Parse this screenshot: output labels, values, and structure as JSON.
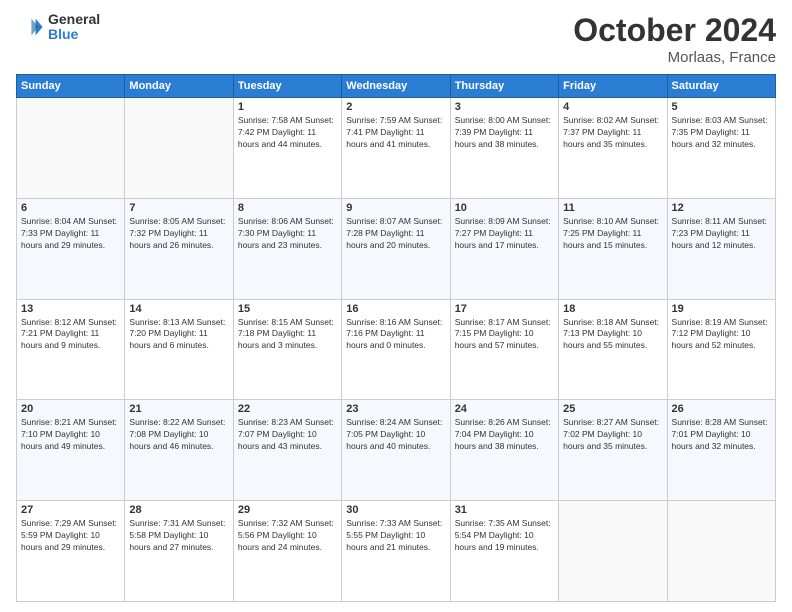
{
  "header": {
    "logo_general": "General",
    "logo_blue": "Blue",
    "title": "October 2024",
    "location": "Morlaas, France"
  },
  "weekdays": [
    "Sunday",
    "Monday",
    "Tuesday",
    "Wednesday",
    "Thursday",
    "Friday",
    "Saturday"
  ],
  "weeks": [
    [
      {
        "day": "",
        "info": ""
      },
      {
        "day": "",
        "info": ""
      },
      {
        "day": "1",
        "info": "Sunrise: 7:58 AM\nSunset: 7:42 PM\nDaylight: 11 hours and 44 minutes."
      },
      {
        "day": "2",
        "info": "Sunrise: 7:59 AM\nSunset: 7:41 PM\nDaylight: 11 hours and 41 minutes."
      },
      {
        "day": "3",
        "info": "Sunrise: 8:00 AM\nSunset: 7:39 PM\nDaylight: 11 hours and 38 minutes."
      },
      {
        "day": "4",
        "info": "Sunrise: 8:02 AM\nSunset: 7:37 PM\nDaylight: 11 hours and 35 minutes."
      },
      {
        "day": "5",
        "info": "Sunrise: 8:03 AM\nSunset: 7:35 PM\nDaylight: 11 hours and 32 minutes."
      }
    ],
    [
      {
        "day": "6",
        "info": "Sunrise: 8:04 AM\nSunset: 7:33 PM\nDaylight: 11 hours and 29 minutes."
      },
      {
        "day": "7",
        "info": "Sunrise: 8:05 AM\nSunset: 7:32 PM\nDaylight: 11 hours and 26 minutes."
      },
      {
        "day": "8",
        "info": "Sunrise: 8:06 AM\nSunset: 7:30 PM\nDaylight: 11 hours and 23 minutes."
      },
      {
        "day": "9",
        "info": "Sunrise: 8:07 AM\nSunset: 7:28 PM\nDaylight: 11 hours and 20 minutes."
      },
      {
        "day": "10",
        "info": "Sunrise: 8:09 AM\nSunset: 7:27 PM\nDaylight: 11 hours and 17 minutes."
      },
      {
        "day": "11",
        "info": "Sunrise: 8:10 AM\nSunset: 7:25 PM\nDaylight: 11 hours and 15 minutes."
      },
      {
        "day": "12",
        "info": "Sunrise: 8:11 AM\nSunset: 7:23 PM\nDaylight: 11 hours and 12 minutes."
      }
    ],
    [
      {
        "day": "13",
        "info": "Sunrise: 8:12 AM\nSunset: 7:21 PM\nDaylight: 11 hours and 9 minutes."
      },
      {
        "day": "14",
        "info": "Sunrise: 8:13 AM\nSunset: 7:20 PM\nDaylight: 11 hours and 6 minutes."
      },
      {
        "day": "15",
        "info": "Sunrise: 8:15 AM\nSunset: 7:18 PM\nDaylight: 11 hours and 3 minutes."
      },
      {
        "day": "16",
        "info": "Sunrise: 8:16 AM\nSunset: 7:16 PM\nDaylight: 11 hours and 0 minutes."
      },
      {
        "day": "17",
        "info": "Sunrise: 8:17 AM\nSunset: 7:15 PM\nDaylight: 10 hours and 57 minutes."
      },
      {
        "day": "18",
        "info": "Sunrise: 8:18 AM\nSunset: 7:13 PM\nDaylight: 10 hours and 55 minutes."
      },
      {
        "day": "19",
        "info": "Sunrise: 8:19 AM\nSunset: 7:12 PM\nDaylight: 10 hours and 52 minutes."
      }
    ],
    [
      {
        "day": "20",
        "info": "Sunrise: 8:21 AM\nSunset: 7:10 PM\nDaylight: 10 hours and 49 minutes."
      },
      {
        "day": "21",
        "info": "Sunrise: 8:22 AM\nSunset: 7:08 PM\nDaylight: 10 hours and 46 minutes."
      },
      {
        "day": "22",
        "info": "Sunrise: 8:23 AM\nSunset: 7:07 PM\nDaylight: 10 hours and 43 minutes."
      },
      {
        "day": "23",
        "info": "Sunrise: 8:24 AM\nSunset: 7:05 PM\nDaylight: 10 hours and 40 minutes."
      },
      {
        "day": "24",
        "info": "Sunrise: 8:26 AM\nSunset: 7:04 PM\nDaylight: 10 hours and 38 minutes."
      },
      {
        "day": "25",
        "info": "Sunrise: 8:27 AM\nSunset: 7:02 PM\nDaylight: 10 hours and 35 minutes."
      },
      {
        "day": "26",
        "info": "Sunrise: 8:28 AM\nSunset: 7:01 PM\nDaylight: 10 hours and 32 minutes."
      }
    ],
    [
      {
        "day": "27",
        "info": "Sunrise: 7:29 AM\nSunset: 5:59 PM\nDaylight: 10 hours and 29 minutes."
      },
      {
        "day": "28",
        "info": "Sunrise: 7:31 AM\nSunset: 5:58 PM\nDaylight: 10 hours and 27 minutes."
      },
      {
        "day": "29",
        "info": "Sunrise: 7:32 AM\nSunset: 5:56 PM\nDaylight: 10 hours and 24 minutes."
      },
      {
        "day": "30",
        "info": "Sunrise: 7:33 AM\nSunset: 5:55 PM\nDaylight: 10 hours and 21 minutes."
      },
      {
        "day": "31",
        "info": "Sunrise: 7:35 AM\nSunset: 5:54 PM\nDaylight: 10 hours and 19 minutes."
      },
      {
        "day": "",
        "info": ""
      },
      {
        "day": "",
        "info": ""
      }
    ]
  ]
}
